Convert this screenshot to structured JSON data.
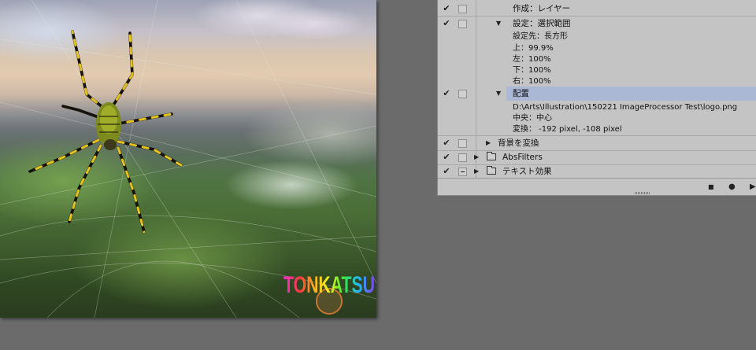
{
  "canvas": {
    "watermark_text": "TONKATSU"
  },
  "panel": {
    "rows": [
      {
        "label": "作成：レイヤー"
      },
      {
        "label": "設定：選択範囲"
      },
      {
        "label": "配置"
      },
      {
        "label": "背景を変換"
      },
      {
        "label": "AbsFilters"
      },
      {
        "label": "テキスト効果"
      }
    ],
    "selection_details": {
      "target": "設定先：長方形",
      "top": "上：99.9%",
      "left": "左：100%",
      "bottom": "下：100%",
      "right": "右：100%"
    },
    "place_details": {
      "path": "D:\\Arts\\Illustration\\150221 ImageProcessor Test\\logo.png",
      "center": "中央：中心",
      "transform": "変換： -192 pixel, -108 pixel"
    },
    "check_glyph": "✔",
    "toolbar": {
      "stop_glyph": "■",
      "record_glyph": "●",
      "play_glyph": "▶"
    }
  }
}
